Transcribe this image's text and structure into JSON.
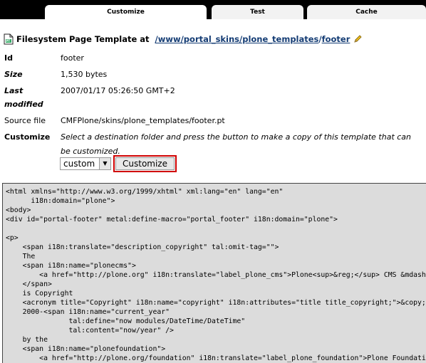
{
  "tabs": [
    {
      "label": "Customize"
    },
    {
      "label": "Test"
    },
    {
      "label": "Cache"
    }
  ],
  "header": {
    "prefix": "Filesystem Page Template at",
    "path_parts": [
      "/www",
      "/portal_skins",
      "/plone_templates",
      "/"
    ],
    "current": "footer"
  },
  "properties": {
    "id": {
      "label": "Id",
      "value": "footer"
    },
    "size": {
      "label": "Size",
      "value": "1,530 bytes"
    },
    "last_modified": {
      "label_line1": "Last",
      "label_line2": "modified",
      "value": "2007/01/17 05:26:50 GMT+2"
    },
    "source_file": {
      "label": "Source file",
      "value": "CMFPlone/skins/plone_templates/footer.pt"
    },
    "customize": {
      "label": "Customize",
      "description": "Select a destination folder and press the button to make a copy of this template that can be customized.",
      "select_value": "custom",
      "button_label": "Customize"
    }
  },
  "code": "<html xmlns=\"http://www.w3.org/1999/xhtml\" xml:lang=\"en\" lang=\"en\"\n      i18n:domain=\"plone\">\n<body>\n<div id=\"portal-footer\" metal:define-macro=\"portal_footer\" i18n:domain=\"plone\">\n\n<p>\n    <span i18n:translate=\"description_copyright\" tal:omit-tag=\"\">\n    The\n    <span i18n:name=\"plonecms\">\n        <a href=\"http://plone.org\" i18n:translate=\"label_plone_cms\">Plone<sup>&reg;</sup> CMS &mdash; Open Source Content Management System</a>\n    </span>\n    is Copyright\n    <acronym title=\"Copyright\" i18n:name=\"copyright\" i18n:attributes=\"title title_copyright;\">&copy;</acronym>\n    2000-<span i18n:name=\"current_year\"\n               tal:define=\"now modules/DateTime/DateTime\"\n               tal:content=\"now/year\" />\n    by the\n    <span i18n:name=\"plonefoundation\">\n        <a href=\"http://plone.org/foundation\" i18n:translate=\"label_plone_foundation\">Plone Foundation</a>"
}
